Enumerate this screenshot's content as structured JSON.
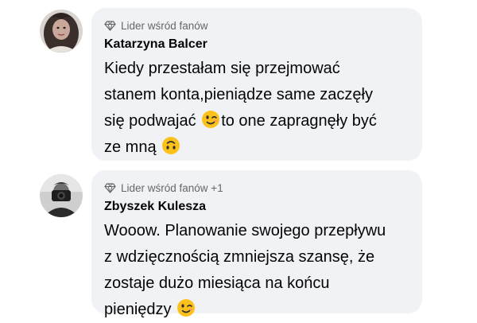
{
  "comments": [
    {
      "badge_label": "Lider wśród fanów",
      "author": "Katarzyna Balcer",
      "line1": "Kiedy przestałam się przejmować",
      "line2": "stanem konta,pieniądze same zaczęły",
      "line3_before": "się podwajać ",
      "line3_after": "to one zapragnęły być",
      "line4": "ze mną ",
      "emojis": [
        "winking-face",
        "upside-down-face"
      ]
    },
    {
      "badge_label": "Lider wśród fanów +1",
      "author": "Zbyszek Kulesza",
      "line1": "Wooow. Planowanie swojego przepływu",
      "line2": "z wdzięcznością zmniejsza szansę, że",
      "line3": "zostaje dużo miesiąca na końcu",
      "line4": "pieniędzy ",
      "emojis": [
        "winking-face"
      ]
    }
  ],
  "colors": {
    "bubble": "#f0f2f5",
    "meta_text": "#65676b",
    "text": "#050505",
    "emoji_face": "#fcc21b"
  }
}
